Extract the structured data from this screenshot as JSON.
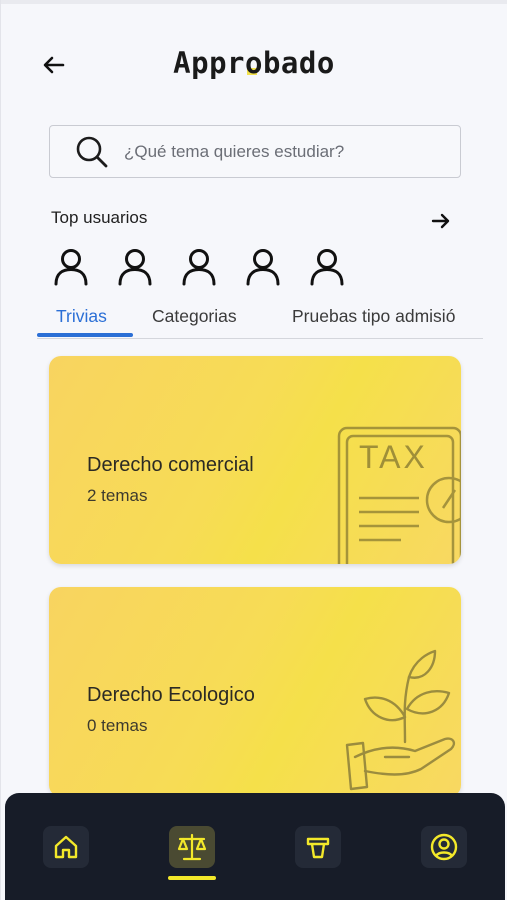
{
  "header": {
    "logo_text": "Approbado",
    "back_icon": "arrow-left-icon"
  },
  "search": {
    "placeholder": "¿Qué tema quieres estudiar?",
    "icon": "search-icon"
  },
  "top_users": {
    "title": "Top usuarios",
    "arrow_icon": "arrow-right-icon",
    "avatars": [
      "user-icon",
      "user-icon",
      "user-icon",
      "user-icon",
      "user-icon"
    ]
  },
  "tabs": [
    {
      "label": "Trivias",
      "active": true
    },
    {
      "label": "Categorias",
      "active": false
    },
    {
      "label": "Pruebas tipo admisió",
      "active": false
    }
  ],
  "cards": [
    {
      "title": "Derecho comercial",
      "subtitle": "2 temas",
      "art_text": "TAX",
      "art_icon": "tax-document-icon"
    },
    {
      "title": "Derecho Ecologico",
      "subtitle": "0 temas",
      "art_icon": "plant-hand-icon"
    }
  ],
  "bottom_nav": {
    "items": [
      {
        "icon": "home-icon",
        "active": false
      },
      {
        "icon": "scales-icon",
        "active": true
      },
      {
        "icon": "podium-icon",
        "active": false
      },
      {
        "icon": "profile-icon",
        "active": false
      }
    ],
    "accent_color": "#f3e82a",
    "background_color": "#171c28"
  },
  "colors": {
    "tab_active": "#2b6fd6",
    "card_yellow": "#f7dc55"
  }
}
